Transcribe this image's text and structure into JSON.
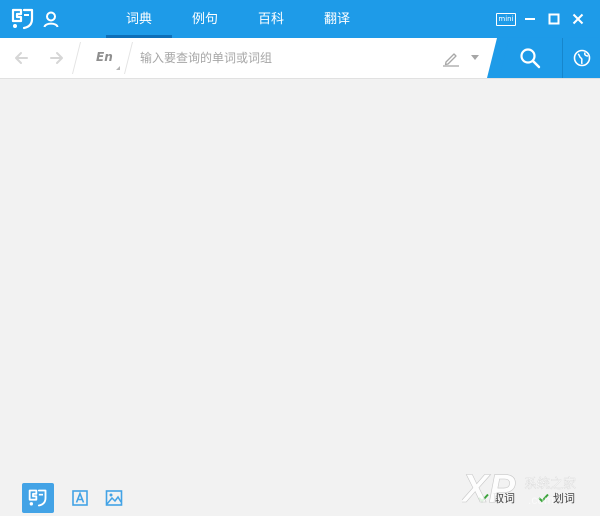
{
  "titlebar": {
    "tabs": [
      {
        "label": "词典",
        "active": true
      },
      {
        "label": "例句",
        "active": false
      },
      {
        "label": "百科",
        "active": false
      },
      {
        "label": "翻译",
        "active": false
      }
    ],
    "mini_label": "mini"
  },
  "searchbar": {
    "language": "En",
    "placeholder": "输入要查询的单词或词组",
    "value": ""
  },
  "bottombar": {
    "options": [
      {
        "label": "取词",
        "checked": true
      },
      {
        "label": "划词",
        "checked": true
      }
    ]
  },
  "watermark": {
    "brand": "XP",
    "site_cn": "系统之家"
  },
  "colors": {
    "accent": "#1e9be8",
    "content_background": "#f2f2f2",
    "check_green": "#3aa43a"
  },
  "icons": [
    "app-logo-icon",
    "user-icon",
    "minimize-icon",
    "maximize-icon",
    "close-icon",
    "back-arrow-icon",
    "forward-arrow-icon",
    "handwriting-icon",
    "search-icon",
    "globe-icon",
    "dictionary-mode-icon",
    "text-mode-icon",
    "image-mode-icon",
    "checkmark-icon"
  ]
}
